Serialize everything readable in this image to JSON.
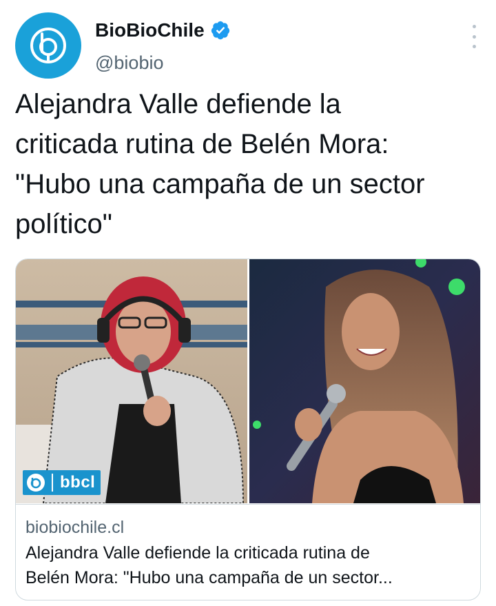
{
  "author": {
    "name": "BioBioChile",
    "handle": "@biobio",
    "verified": true,
    "avatar_icon": "biobio-logo-icon",
    "avatar_color": "#1aa1d9"
  },
  "tweet": {
    "text_lines": [
      "Alejandra Valle defiende la",
      "criticada rutina de Belén Mora:",
      "\"Hubo una campaña de un sector",
      "político\""
    ]
  },
  "card": {
    "image_badge_text": "bbcl",
    "badge_color": "#1a93cd",
    "domain": "biobiochile.cl",
    "title_lines": [
      "Alejandra Valle defiende la criticada rutina de",
      "Belén Mora: \"Hubo una campaña de un sector..."
    ]
  },
  "colors": {
    "text_primary": "#0f1419",
    "text_secondary": "#536471",
    "border": "#cfd9de",
    "verified_blue": "#1d9bf0"
  }
}
